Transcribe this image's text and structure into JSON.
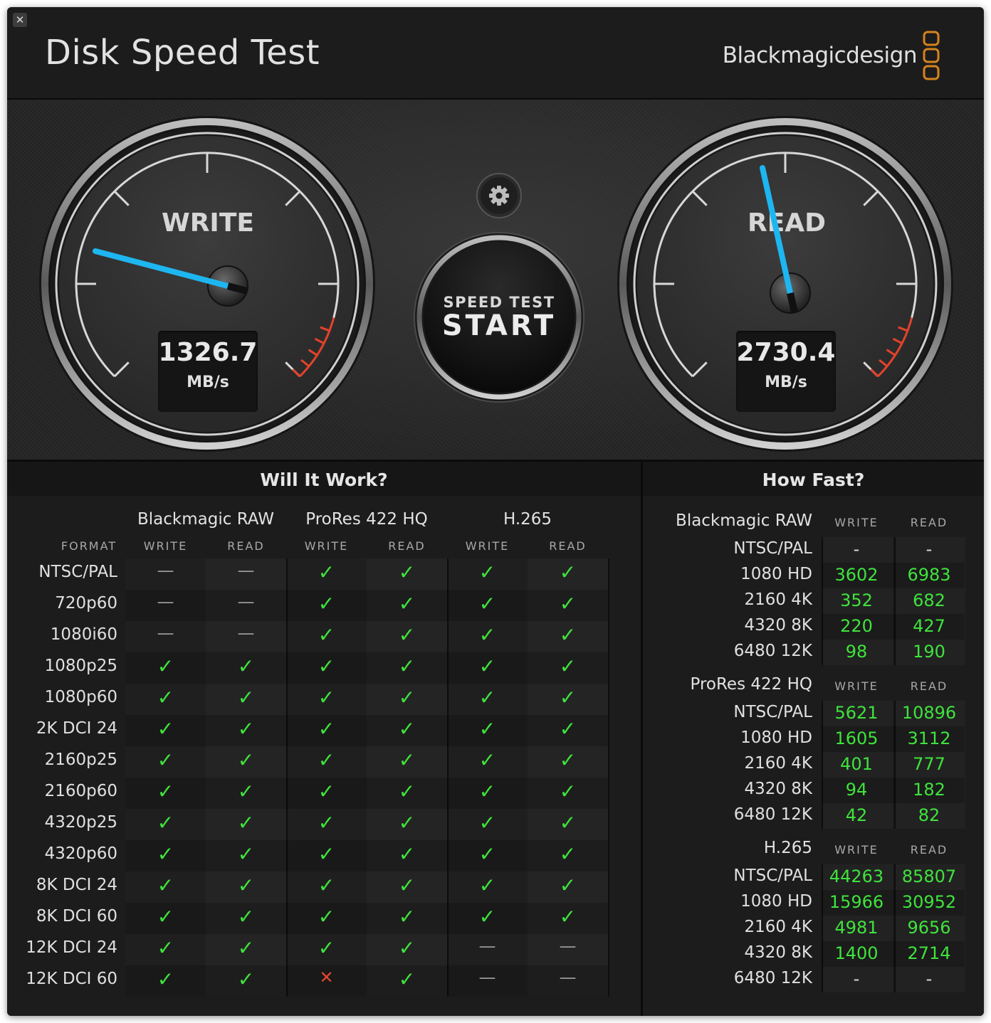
{
  "window": {
    "close_icon": "close-icon",
    "title": "Disk Speed Test",
    "brand": "Blackmagicdesign",
    "brand_color": "#d6831d"
  },
  "gauges": {
    "write": {
      "label": "WRITE",
      "value": "1326.7",
      "unit": "MB/s",
      "needle_color": "#1eb6f0"
    },
    "read": {
      "label": "READ",
      "value": "2730.4",
      "unit": "MB/s",
      "needle_color": "#1eb6f0"
    }
  },
  "controls": {
    "settings_icon": "gear-icon",
    "start_small": "SPEED TEST",
    "start_big": "START"
  },
  "will_it_work": {
    "title": "Will It Work?",
    "format_header": "FORMAT",
    "codecs": [
      "Blackmagic RAW",
      "ProRes 422 HQ",
      "H.265"
    ],
    "sub_headers": [
      "WRITE",
      "READ",
      "WRITE",
      "READ",
      "WRITE",
      "READ"
    ],
    "rows": [
      {
        "format": "NTSC/PAL",
        "cells": [
          "dash",
          "dash",
          "check",
          "check",
          "check",
          "check"
        ]
      },
      {
        "format": "720p60",
        "cells": [
          "dash",
          "dash",
          "check",
          "check",
          "check",
          "check"
        ]
      },
      {
        "format": "1080i60",
        "cells": [
          "dash",
          "dash",
          "check",
          "check",
          "check",
          "check"
        ]
      },
      {
        "format": "1080p25",
        "cells": [
          "check",
          "check",
          "check",
          "check",
          "check",
          "check"
        ]
      },
      {
        "format": "1080p60",
        "cells": [
          "check",
          "check",
          "check",
          "check",
          "check",
          "check"
        ]
      },
      {
        "format": "2K DCI 24",
        "cells": [
          "check",
          "check",
          "check",
          "check",
          "check",
          "check"
        ]
      },
      {
        "format": "2160p25",
        "cells": [
          "check",
          "check",
          "check",
          "check",
          "check",
          "check"
        ]
      },
      {
        "format": "2160p60",
        "cells": [
          "check",
          "check",
          "check",
          "check",
          "check",
          "check"
        ]
      },
      {
        "format": "4320p25",
        "cells": [
          "check",
          "check",
          "check",
          "check",
          "check",
          "check"
        ]
      },
      {
        "format": "4320p60",
        "cells": [
          "check",
          "check",
          "check",
          "check",
          "check",
          "check"
        ]
      },
      {
        "format": "8K DCI 24",
        "cells": [
          "check",
          "check",
          "check",
          "check",
          "check",
          "check"
        ]
      },
      {
        "format": "8K DCI 60",
        "cells": [
          "check",
          "check",
          "check",
          "check",
          "check",
          "check"
        ]
      },
      {
        "format": "12K DCI 24",
        "cells": [
          "check",
          "check",
          "check",
          "check",
          "dash",
          "dash"
        ]
      },
      {
        "format": "12K DCI 60",
        "cells": [
          "check",
          "check",
          "cross",
          "check",
          "dash",
          "dash"
        ]
      }
    ]
  },
  "how_fast": {
    "title": "How Fast?",
    "write_header": "WRITE",
    "read_header": "READ",
    "groups": [
      {
        "codec": "Blackmagic RAW",
        "rows": [
          {
            "format": "NTSC/PAL",
            "write": "-",
            "read": "-"
          },
          {
            "format": "1080 HD",
            "write": "3602",
            "read": "6983"
          },
          {
            "format": "2160 4K",
            "write": "352",
            "read": "682"
          },
          {
            "format": "4320 8K",
            "write": "220",
            "read": "427"
          },
          {
            "format": "6480 12K",
            "write": "98",
            "read": "190"
          }
        ]
      },
      {
        "codec": "ProRes 422 HQ",
        "rows": [
          {
            "format": "NTSC/PAL",
            "write": "5621",
            "read": "10896"
          },
          {
            "format": "1080 HD",
            "write": "1605",
            "read": "3112"
          },
          {
            "format": "2160 4K",
            "write": "401",
            "read": "777"
          },
          {
            "format": "4320 8K",
            "write": "94",
            "read": "182"
          },
          {
            "format": "6480 12K",
            "write": "42",
            "read": "82"
          }
        ]
      },
      {
        "codec": "H.265",
        "rows": [
          {
            "format": "NTSC/PAL",
            "write": "44263",
            "read": "85807"
          },
          {
            "format": "1080 HD",
            "write": "15966",
            "read": "30952"
          },
          {
            "format": "2160 4K",
            "write": "4981",
            "read": "9656"
          },
          {
            "format": "4320 8K",
            "write": "1400",
            "read": "2714"
          },
          {
            "format": "6480 12K",
            "write": "-",
            "read": "-"
          }
        ]
      }
    ]
  }
}
